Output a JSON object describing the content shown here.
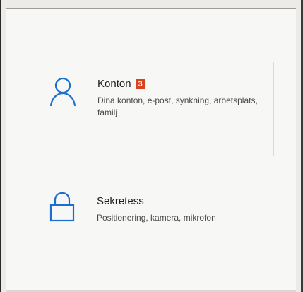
{
  "settings": {
    "tiles": [
      {
        "title": "Konton",
        "badge": "3",
        "description": "Dina konton, e-post, synkning, arbetsplats, familj",
        "icon": "person-icon"
      },
      {
        "title": "Sekretess",
        "description": "Positionering, kamera, mikrofon",
        "icon": "lock-icon"
      }
    ],
    "accent_color": "#1a6fd1",
    "badge_color": "#d8431f"
  }
}
